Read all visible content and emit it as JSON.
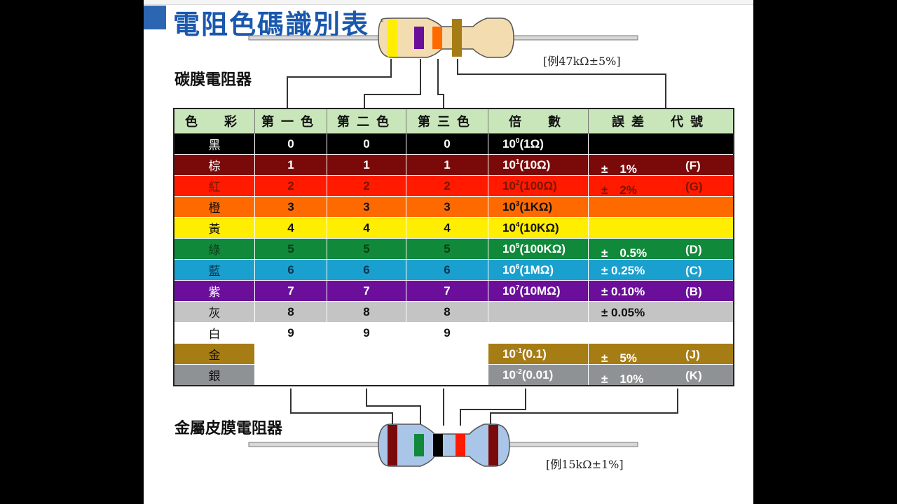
{
  "page_title": "電阻色碼識別表",
  "carbon_label": "碳膜電阻器",
  "metal_label": "金屬皮膜電阻器",
  "carbon_example": "[例47kΩ±5%]",
  "metal_example": "[例15kΩ±1%]",
  "headers": [
    "色　彩",
    "第一色",
    "第二色",
    "第三色",
    "倍　數",
    "誤差　代號"
  ],
  "rows": [
    {
      "name": "黑",
      "bg": "#000000",
      "fg": "#ffffff",
      "d1": "0",
      "d2": "0",
      "d3": "0",
      "mult_exp": "0",
      "mult_val": "(1Ω)",
      "tol": "",
      "code": "",
      "mult_bg": "#000000",
      "mult_fg": "#ffffff",
      "tol_bg": "#000000",
      "tol_fg": "#ffffff"
    },
    {
      "name": "棕",
      "bg": "#7a0a0a",
      "fg": "#ffffff",
      "d1": "1",
      "d2": "1",
      "d3": "1",
      "mult_exp": "1",
      "mult_val": "(10Ω)",
      "tol": "±　1%",
      "code": "(F)",
      "mult_bg": "#7a0a0a",
      "mult_fg": "#ffffff",
      "tol_bg": "#7a0a0a",
      "tol_fg": "#ffffff"
    },
    {
      "name": "紅",
      "bg": "#ff1a00",
      "fg": "#7a1500",
      "d1": "2",
      "d2": "2",
      "d3": "2",
      "mult_exp": "2",
      "mult_val": "(100Ω)",
      "tol": "±　2%",
      "code": "(G)",
      "mult_bg": "#ff1a00",
      "mult_fg": "#7a1500",
      "tol_bg": "#ff1a00",
      "tol_fg": "#7a1500"
    },
    {
      "name": "橙",
      "bg": "#ff6a00",
      "fg": "#111111",
      "d1": "3",
      "d2": "3",
      "d3": "3",
      "mult_exp": "3",
      "mult_val": "(1KΩ)",
      "tol": "",
      "code": "",
      "mult_bg": "#ff6a00",
      "mult_fg": "#111111",
      "tol_bg": "#ff6a00",
      "tol_fg": "#111111"
    },
    {
      "name": "黃",
      "bg": "#ffee00",
      "fg": "#111111",
      "d1": "4",
      "d2": "4",
      "d3": "4",
      "mult_exp": "4",
      "mult_val": "(10KΩ)",
      "tol": "",
      "code": "",
      "mult_bg": "#ffee00",
      "mult_fg": "#111111",
      "tol_bg": "#ffee00",
      "tol_fg": "#111111"
    },
    {
      "name": "綠",
      "bg": "#11893a",
      "fg": "#0a3d18",
      "d1": "5",
      "d2": "5",
      "d3": "5",
      "mult_exp": "5",
      "mult_val": "(100KΩ)",
      "tol": "±　0.5%",
      "code": "(D)",
      "mult_bg": "#11893a",
      "mult_fg": "#ffffff",
      "tol_bg": "#11893a",
      "tol_fg": "#ffffff"
    },
    {
      "name": "藍",
      "bg": "#1aa0cf",
      "fg": "#0a3550",
      "d1": "6",
      "d2": "6",
      "d3": "6",
      "mult_exp": "6",
      "mult_val": "(1MΩ)",
      "tol": "± 0.25%",
      "code": "(C)",
      "mult_bg": "#1aa0cf",
      "mult_fg": "#ffffff",
      "tol_bg": "#1aa0cf",
      "tol_fg": "#ffffff"
    },
    {
      "name": "紫",
      "bg": "#6b0f9a",
      "fg": "#ffffff",
      "d1": "7",
      "d2": "7",
      "d3": "7",
      "mult_exp": "7",
      "mult_val": "(10MΩ)",
      "tol": "± 0.10%",
      "code": "(B)",
      "mult_bg": "#6b0f9a",
      "mult_fg": "#ffffff",
      "tol_bg": "#6b0f9a",
      "tol_fg": "#ffffff"
    },
    {
      "name": "灰",
      "bg": "#c4c4c4",
      "fg": "#111111",
      "d1": "8",
      "d2": "8",
      "d3": "8",
      "mult_exp": "",
      "mult_val": "",
      "tol": "± 0.05%",
      "code": "",
      "mult_bg": "#c4c4c4",
      "mult_fg": "#111111",
      "tol_bg": "#c4c4c4",
      "tol_fg": "#111111"
    },
    {
      "name": "白",
      "bg": "#ffffff",
      "fg": "#111111",
      "d1": "9",
      "d2": "9",
      "d3": "9",
      "mult_exp": "",
      "mult_val": "",
      "tol": "",
      "code": "",
      "mult_bg": "#ffffff",
      "mult_fg": "#111111",
      "tol_bg": "#ffffff",
      "tol_fg": "#111111"
    },
    {
      "name": "金",
      "bg": "#a67c14",
      "fg": "#111111",
      "d1": "",
      "d2": "",
      "d3": "",
      "mult_exp": "-1",
      "mult_val": "(0.1)",
      "tol": "±　5%",
      "code": "(J)",
      "mult_bg": "#a67c14",
      "mult_fg": "#ffffff",
      "tol_bg": "#a67c14",
      "tol_fg": "#ffffff",
      "digit_bg": "#ffffff"
    },
    {
      "name": "銀",
      "bg": "#8f9294",
      "fg": "#111111",
      "d1": "",
      "d2": "",
      "d3": "",
      "mult_exp": "-2",
      "mult_val": "(0.01)",
      "tol": "±　10%",
      "code": "(K)",
      "mult_bg": "#8f9294",
      "mult_fg": "#ffffff",
      "tol_bg": "#8f9294",
      "tol_fg": "#ffffff",
      "digit_bg": "#ffffff"
    }
  ],
  "colors": {
    "title_blue": "#1a58ad",
    "header_green": "#c8e6b9",
    "resistor_carbon": "#f3dcb0",
    "resistor_metal": "#a9c6e8"
  },
  "carbon_bands": [
    "#ffee00",
    "#6b0f9a",
    "#ff6a00",
    "#a67c14"
  ],
  "metal_bands": [
    "#7a0a0a",
    "#11893a",
    "#000000",
    "#ff1a00",
    "#7a0a0a"
  ]
}
